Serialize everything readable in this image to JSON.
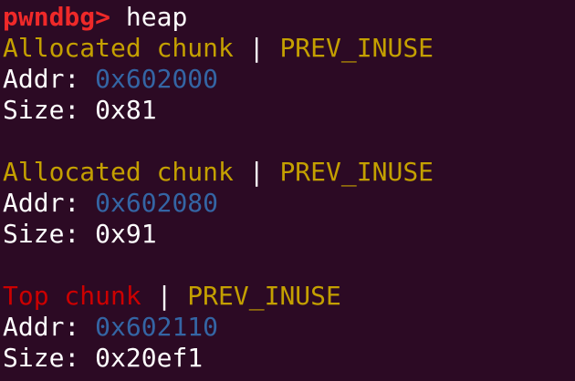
{
  "prompt": {
    "name": "pwndbg>",
    "command": "heap"
  },
  "chunks": [
    {
      "type": "Allocated chunk",
      "separator": "|",
      "flag": "PREV_INUSE",
      "addr_label": "Addr:",
      "addr": "0x602000",
      "size_label": "Size:",
      "size": "0x81"
    },
    {
      "type": "Allocated chunk",
      "separator": "|",
      "flag": "PREV_INUSE",
      "addr_label": "Addr:",
      "addr": "0x602080",
      "size_label": "Size:",
      "size": "0x91"
    },
    {
      "type": "Top chunk",
      "separator": "|",
      "flag": "PREV_INUSE",
      "addr_label": "Addr:",
      "addr": "0x602110",
      "size_label": "Size:",
      "size": "0x20ef1"
    }
  ],
  "colors": {
    "background": "#2c0a24",
    "prompt": "#ef2929",
    "allocated": "#c4a000",
    "top": "#cc0000",
    "address": "#3465a4",
    "text": "#ffffff"
  }
}
